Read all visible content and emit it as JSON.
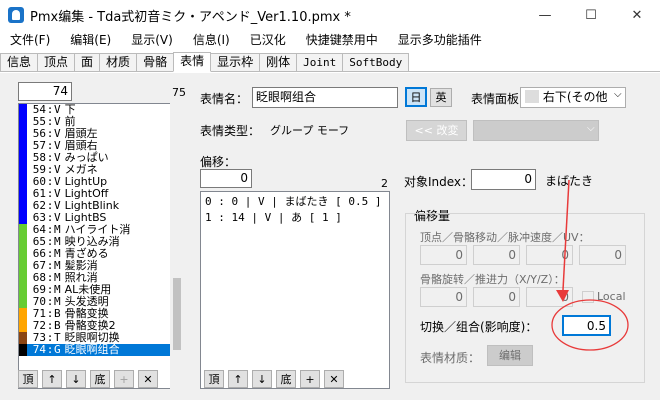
{
  "window": {
    "title": "Pmx编集 - Tda式初音ミク・アペンド_Ver1.10.pmx *",
    "minimize": "—",
    "maximize": "☐",
    "close": "✕"
  },
  "menu": [
    "文件(F)",
    "编辑(E)",
    "显示(V)",
    "信息(I)",
    "已汉化",
    "快捷键禁用中",
    "显示多功能插件"
  ],
  "tabs": [
    "信息",
    "顶点",
    "面",
    "材质",
    "骨骼",
    "表情",
    "显示枠",
    "刚体",
    "Joint",
    "SoftBody"
  ],
  "morph_panel": {
    "current_index": "74",
    "count": "75",
    "rows": [
      {
        "idx": "54",
        "type": "V",
        "name": "下",
        "color": "#0000ff"
      },
      {
        "idx": "55",
        "type": "V",
        "name": "前",
        "color": "#0000ff"
      },
      {
        "idx": "56",
        "type": "V",
        "name": "眉頭左",
        "color": "#0000ff"
      },
      {
        "idx": "57",
        "type": "V",
        "name": "眉頭右",
        "color": "#0000ff"
      },
      {
        "idx": "58",
        "type": "V",
        "name": "みっぱい",
        "color": "#0000ff"
      },
      {
        "idx": "59",
        "type": "V",
        "name": "メガネ",
        "color": "#0000ff"
      },
      {
        "idx": "60",
        "type": "V",
        "name": "LightUp",
        "color": "#0000ff"
      },
      {
        "idx": "61",
        "type": "V",
        "name": "LightOff",
        "color": "#0000ff"
      },
      {
        "idx": "62",
        "type": "V",
        "name": "LightBlink",
        "color": "#0000ff"
      },
      {
        "idx": "63",
        "type": "V",
        "name": "LightBS",
        "color": "#0000ff"
      },
      {
        "idx": "64",
        "type": "M",
        "name": "ハイライト消",
        "color": "#66cc33"
      },
      {
        "idx": "65",
        "type": "M",
        "name": "映り込み消",
        "color": "#66cc33"
      },
      {
        "idx": "66",
        "type": "M",
        "name": "青ざめる",
        "color": "#66cc33"
      },
      {
        "idx": "67",
        "type": "M",
        "name": "髪影消",
        "color": "#66cc33"
      },
      {
        "idx": "68",
        "type": "M",
        "name": "照れ消",
        "color": "#66cc33"
      },
      {
        "idx": "69",
        "type": "M",
        "name": "AL未使用",
        "color": "#66cc33"
      },
      {
        "idx": "70",
        "type": "M",
        "name": "头发透明",
        "color": "#66cc33"
      },
      {
        "idx": "71",
        "type": "B",
        "name": "骨骼变换",
        "color": "#ffa500"
      },
      {
        "idx": "72",
        "type": "B",
        "name": "骨骼变换2",
        "color": "#ffa500"
      },
      {
        "idx": "73",
        "type": "T",
        "name": "眨眼啊切换",
        "color": "#8b4513"
      },
      {
        "idx": "74",
        "type": "G",
        "name": "眨眼啊组合",
        "color": "#000000",
        "selected": true
      }
    ],
    "buttons": [
      "頂",
      "↑",
      "↓",
      "底",
      "+",
      "✕"
    ]
  },
  "morph_name": {
    "label": "表情名：",
    "value": "眨眼啊组合",
    "lang_jp": "日",
    "lang_en": "英",
    "panel_label": "表情面板",
    "panel_value": "右下(その他"
  },
  "morph_type": {
    "label": "表情类型：",
    "value": "グループ モーフ",
    "convert_button": "<< 改変"
  },
  "offset": {
    "label": "偏移：",
    "index": "0",
    "count": "2",
    "rows": [
      "0 : 0 | V | まばたき [ 0.5 ]",
      "1 : 14 | V | あ [ 1 ]"
    ],
    "buttons": [
      "頂",
      "↑",
      "↓",
      "底",
      "+",
      "✕"
    ]
  },
  "target": {
    "label": "对象Index：",
    "value": "0",
    "name": "まばたき"
  },
  "offset_group": {
    "title": "偏移量",
    "vertex_label": "顶点／骨骼移动／脉冲速度／UV：",
    "vertex_values": [
      "0",
      "0",
      "0",
      "0"
    ],
    "rot_label": "骨骼旋转／推进力（X/Y/Z）：",
    "rot_values": [
      "0",
      "0",
      "0"
    ],
    "local_label": "Local",
    "group_label": "切换／组合(影响度)：",
    "group_value": "0.5",
    "material_label": "表情材质：",
    "edit_button": "编辑"
  },
  "colors": {
    "highlight": "#0078d7",
    "annotation": "#e83a3a"
  }
}
